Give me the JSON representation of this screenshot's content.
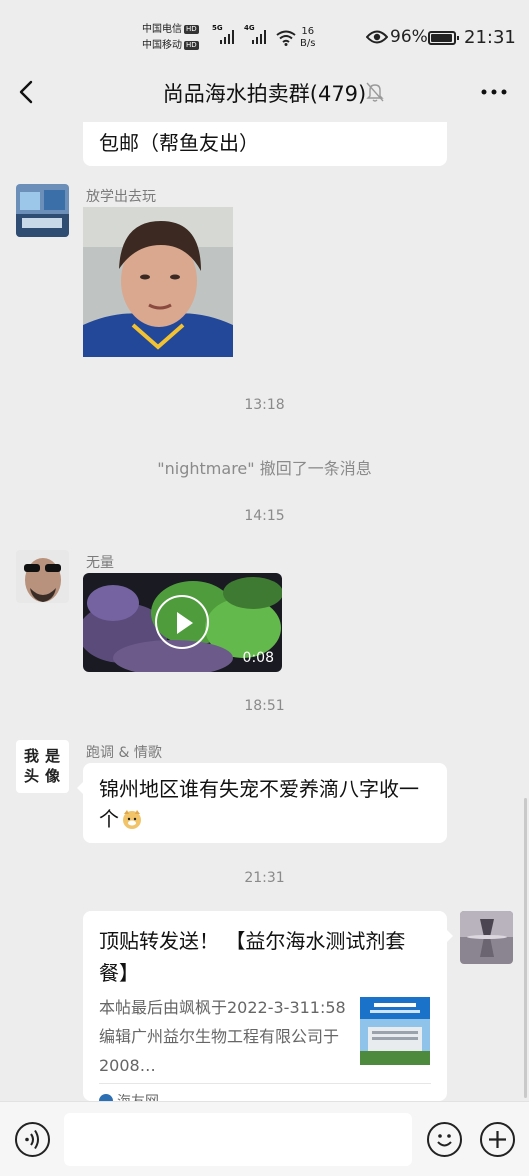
{
  "status_bar": {
    "carrier1": "中国电信",
    "carrier2": "中国移动",
    "hd": "HD",
    "sig1_label": "5G",
    "sig2_label": "4G",
    "speed_value": "16",
    "speed_unit": "B/s",
    "battery": "96%",
    "battery_level": 0.96,
    "time": "21:31"
  },
  "header": {
    "title": "尚品海水拍卖群(479)",
    "icons": [
      "back-arrow-icon",
      "mute-bell-icon",
      "more-icon"
    ]
  },
  "messages": {
    "partial_bubble_text": "包邮（帮鱼友出）",
    "msg1_sender": "放学出去玩",
    "time1": "13:18",
    "recall_notice": "\"nightmare\" 撤回了一条消息",
    "time2": "14:15",
    "msg2_sender": "无量",
    "video_duration": "0:08",
    "time3": "18:51",
    "msg3_sender": "跑调 & 情歌",
    "msg3_avatar_text": "我是头像",
    "msg3_text": "锦州地区谁有失宠不爱养滴八字收一个",
    "time4": "21:31",
    "card_title": "顶贴转发送！ 【益尔海水测试剂套餐】",
    "card_desc": "本帖最后由飒枫于2022-3-311:58编辑广州益尔生物工程有限公司于2008…",
    "card_source": "海友网"
  },
  "input_bar": {
    "icons": [
      "voice-icon",
      "emoji-icon",
      "plus-icon"
    ]
  },
  "colors": {
    "background": "#ededed",
    "bubble": "#ffffff",
    "meta_text": "#8a8a8a"
  }
}
